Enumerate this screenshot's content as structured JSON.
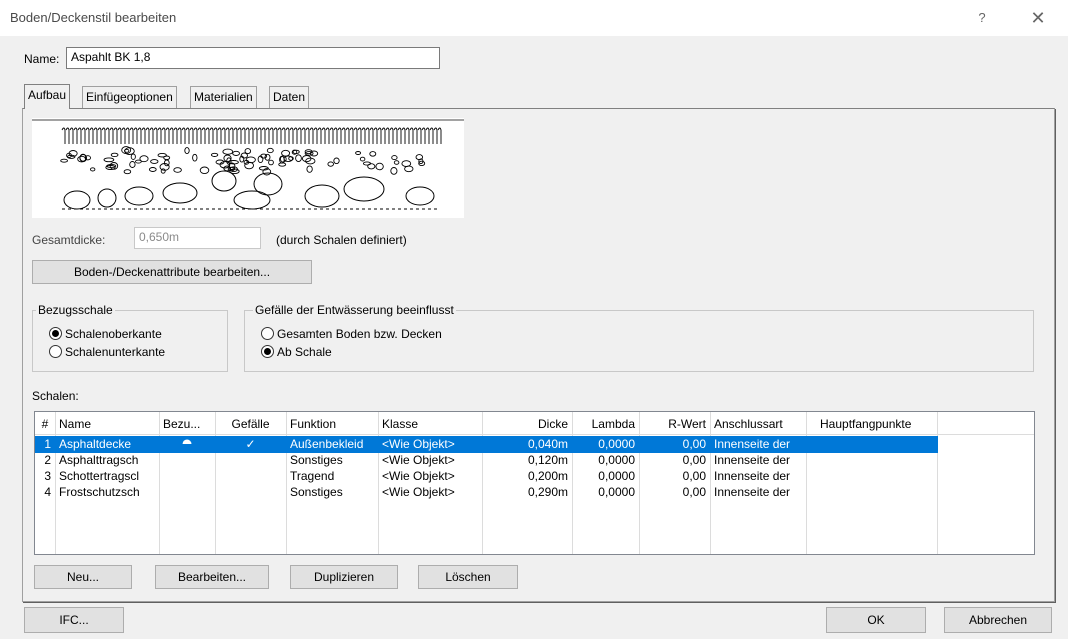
{
  "window": {
    "title": "Boden/Deckenstil bearbeiten",
    "help_label": "?",
    "close_label": "✕"
  },
  "name_field": {
    "label": "Name:",
    "value": "Aspahlt BK 1,8"
  },
  "tabs": [
    {
      "label": "Aufbau",
      "active": true
    },
    {
      "label": "Einfügeoptionen",
      "active": false
    },
    {
      "label": "Materialien",
      "active": false
    },
    {
      "label": "Daten",
      "active": false
    }
  ],
  "gesamtdicke": {
    "label": "Gesamtdicke:",
    "value": "0,650m",
    "note": "(durch Schalen definiert)"
  },
  "attr_button": "Boden-/Deckenattribute bearbeiten...",
  "bezugsschale": {
    "title": "Bezugsschale",
    "options": [
      {
        "label": "Schalenoberkante",
        "checked": true
      },
      {
        "label": "Schalenunterkante",
        "checked": false
      }
    ]
  },
  "gefaelle_group": {
    "title": "Gefälle der Entwässerung beeinflusst",
    "options": [
      {
        "label": "Gesamten Boden bzw. Decken",
        "checked": false
      },
      {
        "label": "Ab Schale",
        "checked": true
      }
    ]
  },
  "schalen": {
    "label": "Schalen:",
    "columns": [
      "#",
      "Name",
      "Bezu...",
      "Gefälle",
      "Funktion",
      "Klasse",
      "Dicke",
      "Lambda",
      "R-Wert",
      "Anschlussart",
      "Hauptfangpunkte"
    ],
    "rows": [
      {
        "num": "1",
        "name": "Asphaltdecke",
        "bezu": "⯊",
        "gefaelle": "✓",
        "funktion": "Außenbekleid",
        "klasse": "<Wie Objekt>",
        "dicke": "0,040m",
        "lambda": "0,0000",
        "rwert": "0,00",
        "anschluss": "Innenseite der",
        "haupt": "",
        "selected": true
      },
      {
        "num": "2",
        "name": "Asphalttragsch",
        "bezu": "",
        "gefaelle": "",
        "funktion": "Sonstiges",
        "klasse": "<Wie Objekt>",
        "dicke": "0,120m",
        "lambda": "0,0000",
        "rwert": "0,00",
        "anschluss": "Innenseite der",
        "haupt": "",
        "selected": false
      },
      {
        "num": "3",
        "name": "Schottertragscl",
        "bezu": "",
        "gefaelle": "",
        "funktion": "Tragend",
        "klasse": "<Wie Objekt>",
        "dicke": "0,200m",
        "lambda": "0,0000",
        "rwert": "0,00",
        "anschluss": "Innenseite der",
        "haupt": "",
        "selected": false
      },
      {
        "num": "4",
        "name": "Frostschutzsch",
        "bezu": "",
        "gefaelle": "",
        "funktion": "Sonstiges",
        "klasse": "<Wie Objekt>",
        "dicke": "0,290m",
        "lambda": "0,0000",
        "rwert": "0,00",
        "anschluss": "Innenseite der",
        "haupt": "",
        "selected": false
      }
    ]
  },
  "table_buttons": {
    "neu": "Neu...",
    "bearbeiten": "Bearbeiten...",
    "duplizieren": "Duplizieren",
    "loeschen": "Löschen"
  },
  "footer": {
    "ifc": "IFC...",
    "ok": "OK",
    "abbrechen": "Abbrechen"
  },
  "colors": {
    "selection": "#0078d7",
    "background": "#f0f0f0"
  }
}
